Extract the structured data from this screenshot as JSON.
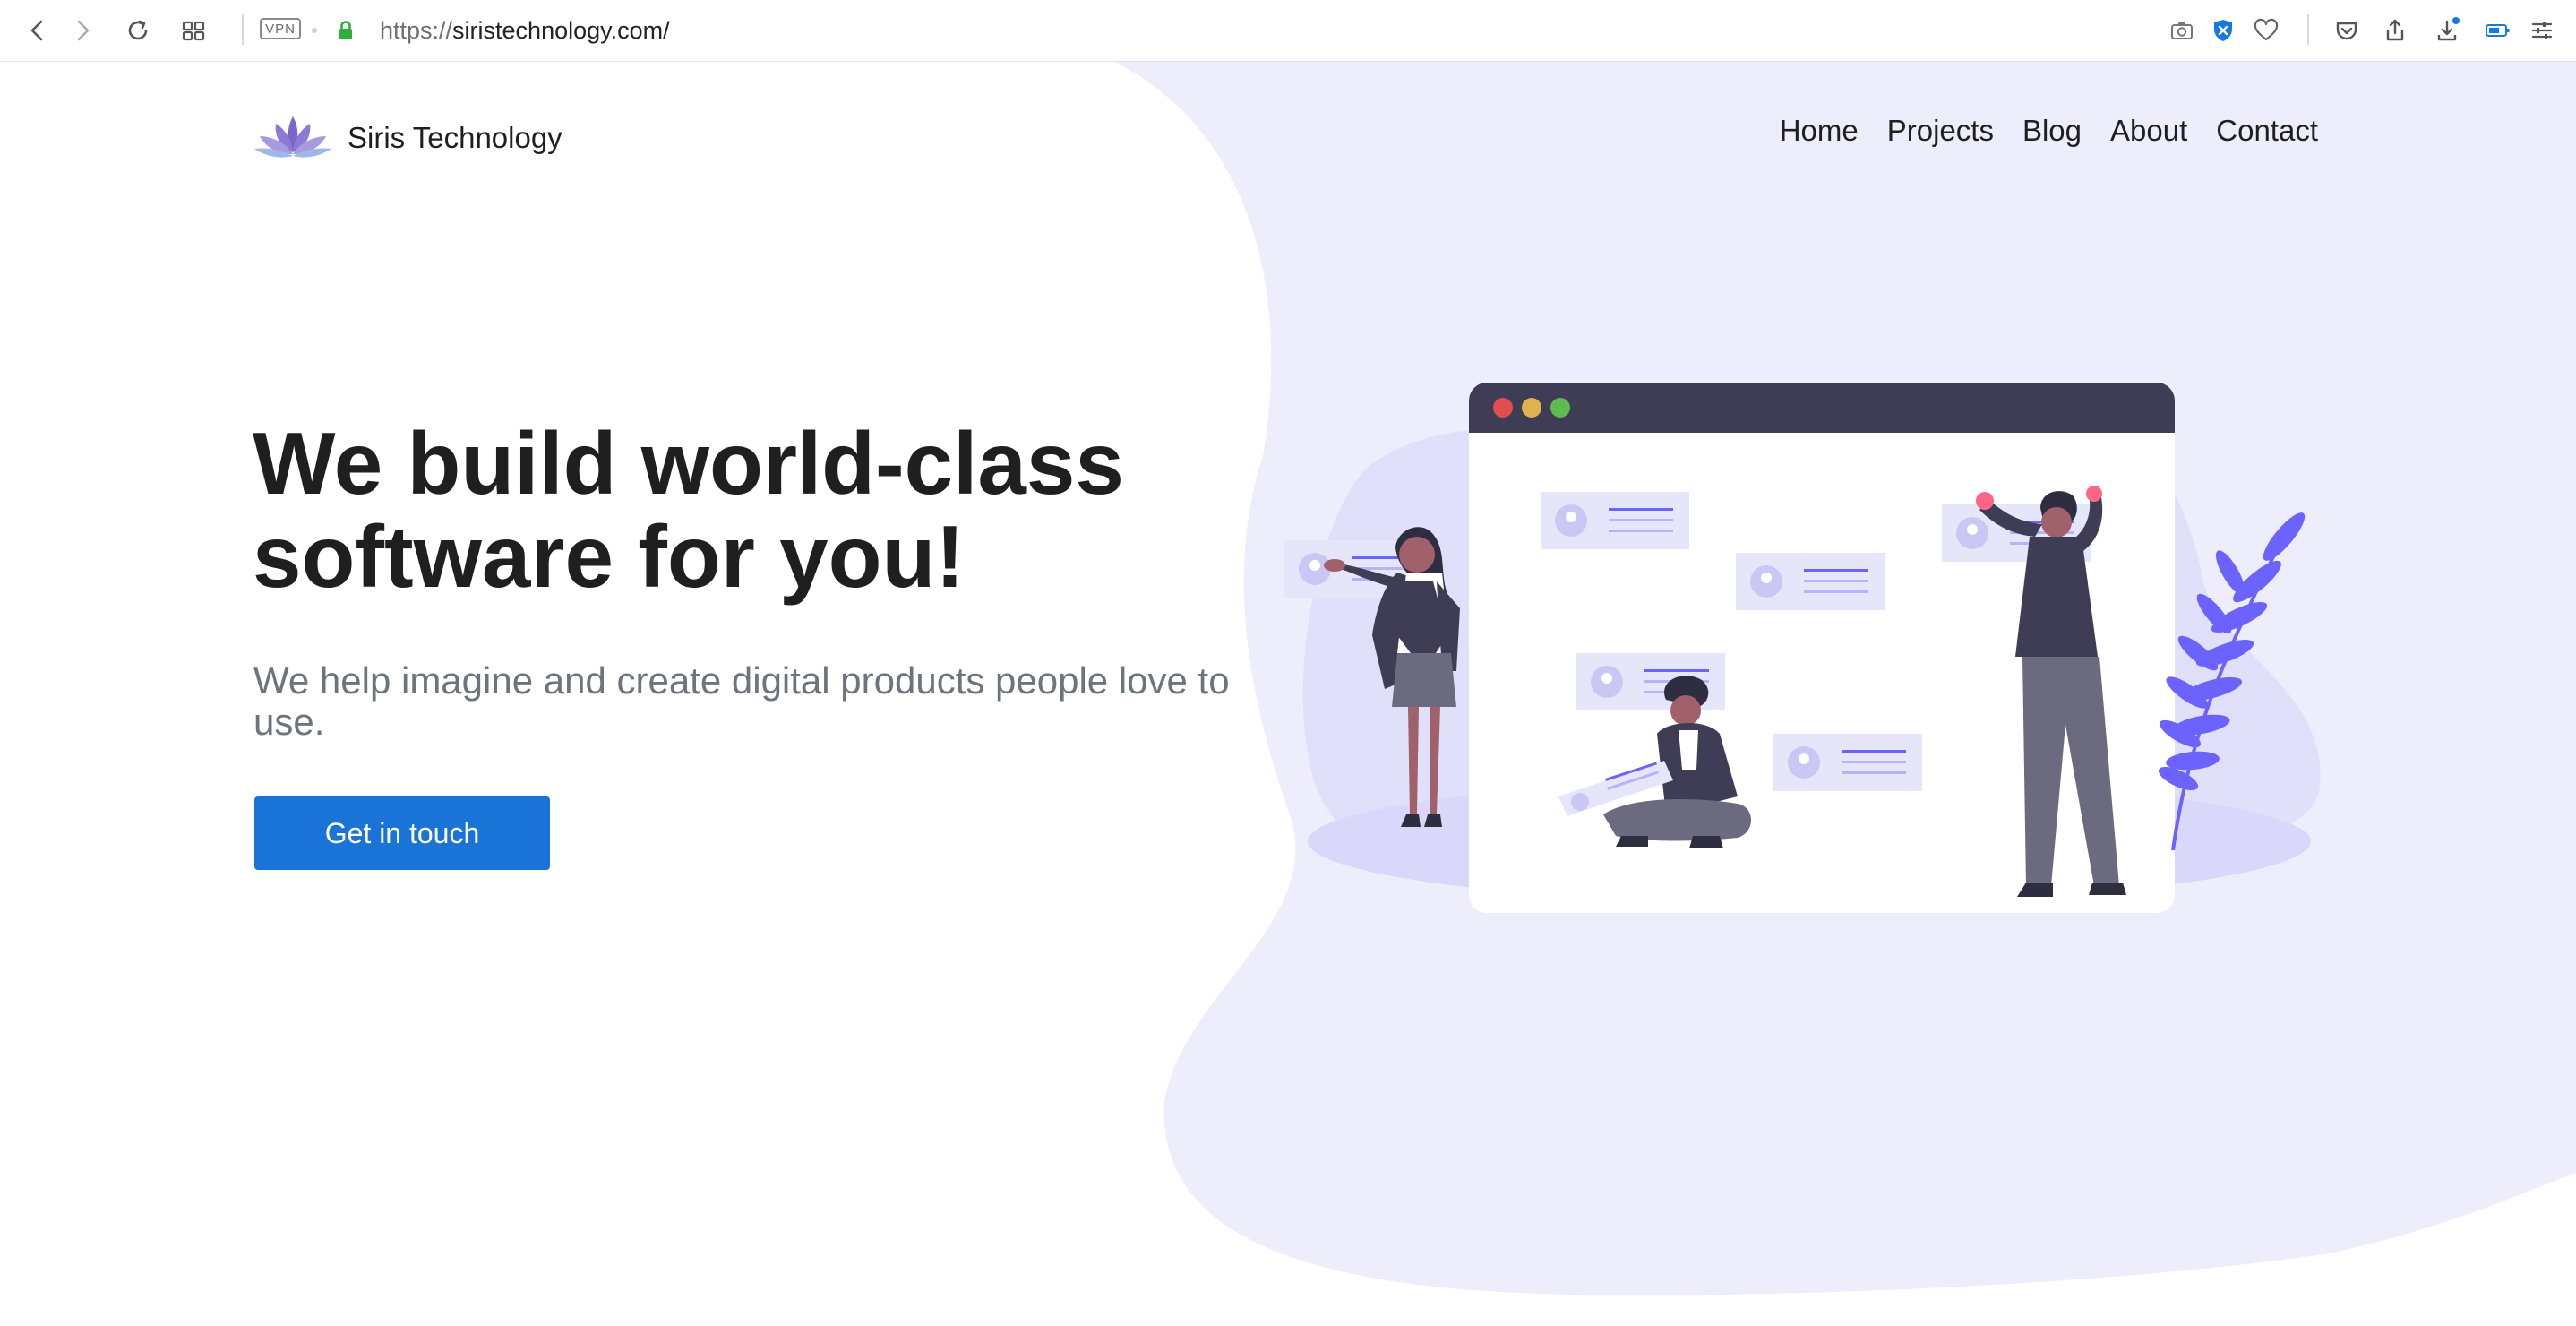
{
  "browser": {
    "vpn_label": "VPN",
    "url_protocol": "https://",
    "url_host": "siristechnology.com/",
    "icons": [
      "back-icon",
      "forward-icon",
      "reload-icon",
      "tabs-grid-icon",
      "lock-icon",
      "camera-icon",
      "shield-icon",
      "heart-icon",
      "pocket-icon",
      "share-icon",
      "download-icon",
      "battery-icon",
      "settings-sliders-icon"
    ]
  },
  "site": {
    "brand": "Siris Technology",
    "nav": [
      "Home",
      "Projects",
      "Blog",
      "About",
      "Contact"
    ],
    "hero": {
      "title_line1": "We build world-class",
      "title_line2": "software for you!",
      "subtitle": "We help imagine and create digital products people love to use.",
      "cta": "Get in touch"
    }
  },
  "colors": {
    "primary": "#1a74d8",
    "blob": "#ededfc",
    "illustration_accent": "#6c63ff",
    "text_dark": "#1f1f1f",
    "text_muted": "#6c757d"
  }
}
